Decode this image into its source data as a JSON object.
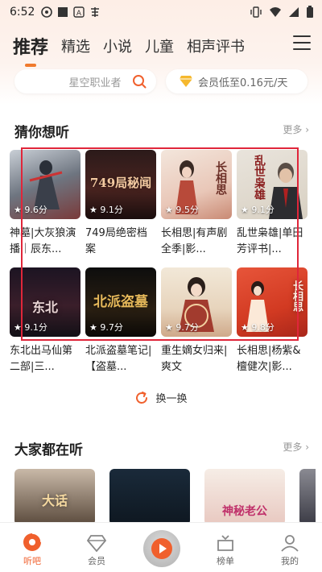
{
  "status_bar": {
    "time": "6:52"
  },
  "tabs": [
    {
      "label": "推荐",
      "active": true
    },
    {
      "label": "精选",
      "active": false
    },
    {
      "label": "小说",
      "active": false
    },
    {
      "label": "儿童",
      "active": false
    },
    {
      "label": "相声评书",
      "active": false
    }
  ],
  "search": {
    "placeholder": "星空职业者"
  },
  "vip": {
    "text": "会员低至0.16元/天"
  },
  "section1": {
    "title": "猜你想听",
    "more": "更多 ›"
  },
  "items": [
    {
      "title": "神墓|大灰狼演播｜辰东...",
      "score": "9.6分",
      "cover_text": ""
    },
    {
      "title": "749局绝密档案",
      "score": "9.1分",
      "cover_text": "749局秘闻"
    },
    {
      "title": "长相思|有声剧 全季|影...",
      "score": "9.5分",
      "cover_text": "长相思"
    },
    {
      "title": "乱世枭雄|单田芳评书|...",
      "score": "9.1分",
      "cover_text": "乱世枭雄"
    },
    {
      "title": "东北出马仙第二部|三...",
      "score": "9.1分",
      "cover_text": "东北"
    },
    {
      "title": "北派盗墓笔记|【盗墓...",
      "score": "9.7分",
      "cover_text": "北派盗墓"
    },
    {
      "title": "重生嫡女归来|爽文",
      "score": "9.7分",
      "cover_text": ""
    },
    {
      "title": "长相思|杨紫&檀健次|影...",
      "score": "9.8分",
      "cover_text": "长相思"
    }
  ],
  "refresh": {
    "label": "换一换"
  },
  "section2": {
    "title": "大家都在听",
    "more": "更多 ›"
  },
  "row2_items": [
    {
      "cover_text": "大话"
    },
    {
      "cover_text": ""
    },
    {
      "cover_text": "神秘老公"
    }
  ],
  "bottom_nav": [
    {
      "label": "听吧",
      "active": true
    },
    {
      "label": "会员",
      "active": false
    },
    {
      "label": "榜单",
      "active": false
    },
    {
      "label": "我的",
      "active": false
    }
  ],
  "colors": {
    "accent": "#f0602d",
    "highlight": "#e0263a"
  }
}
